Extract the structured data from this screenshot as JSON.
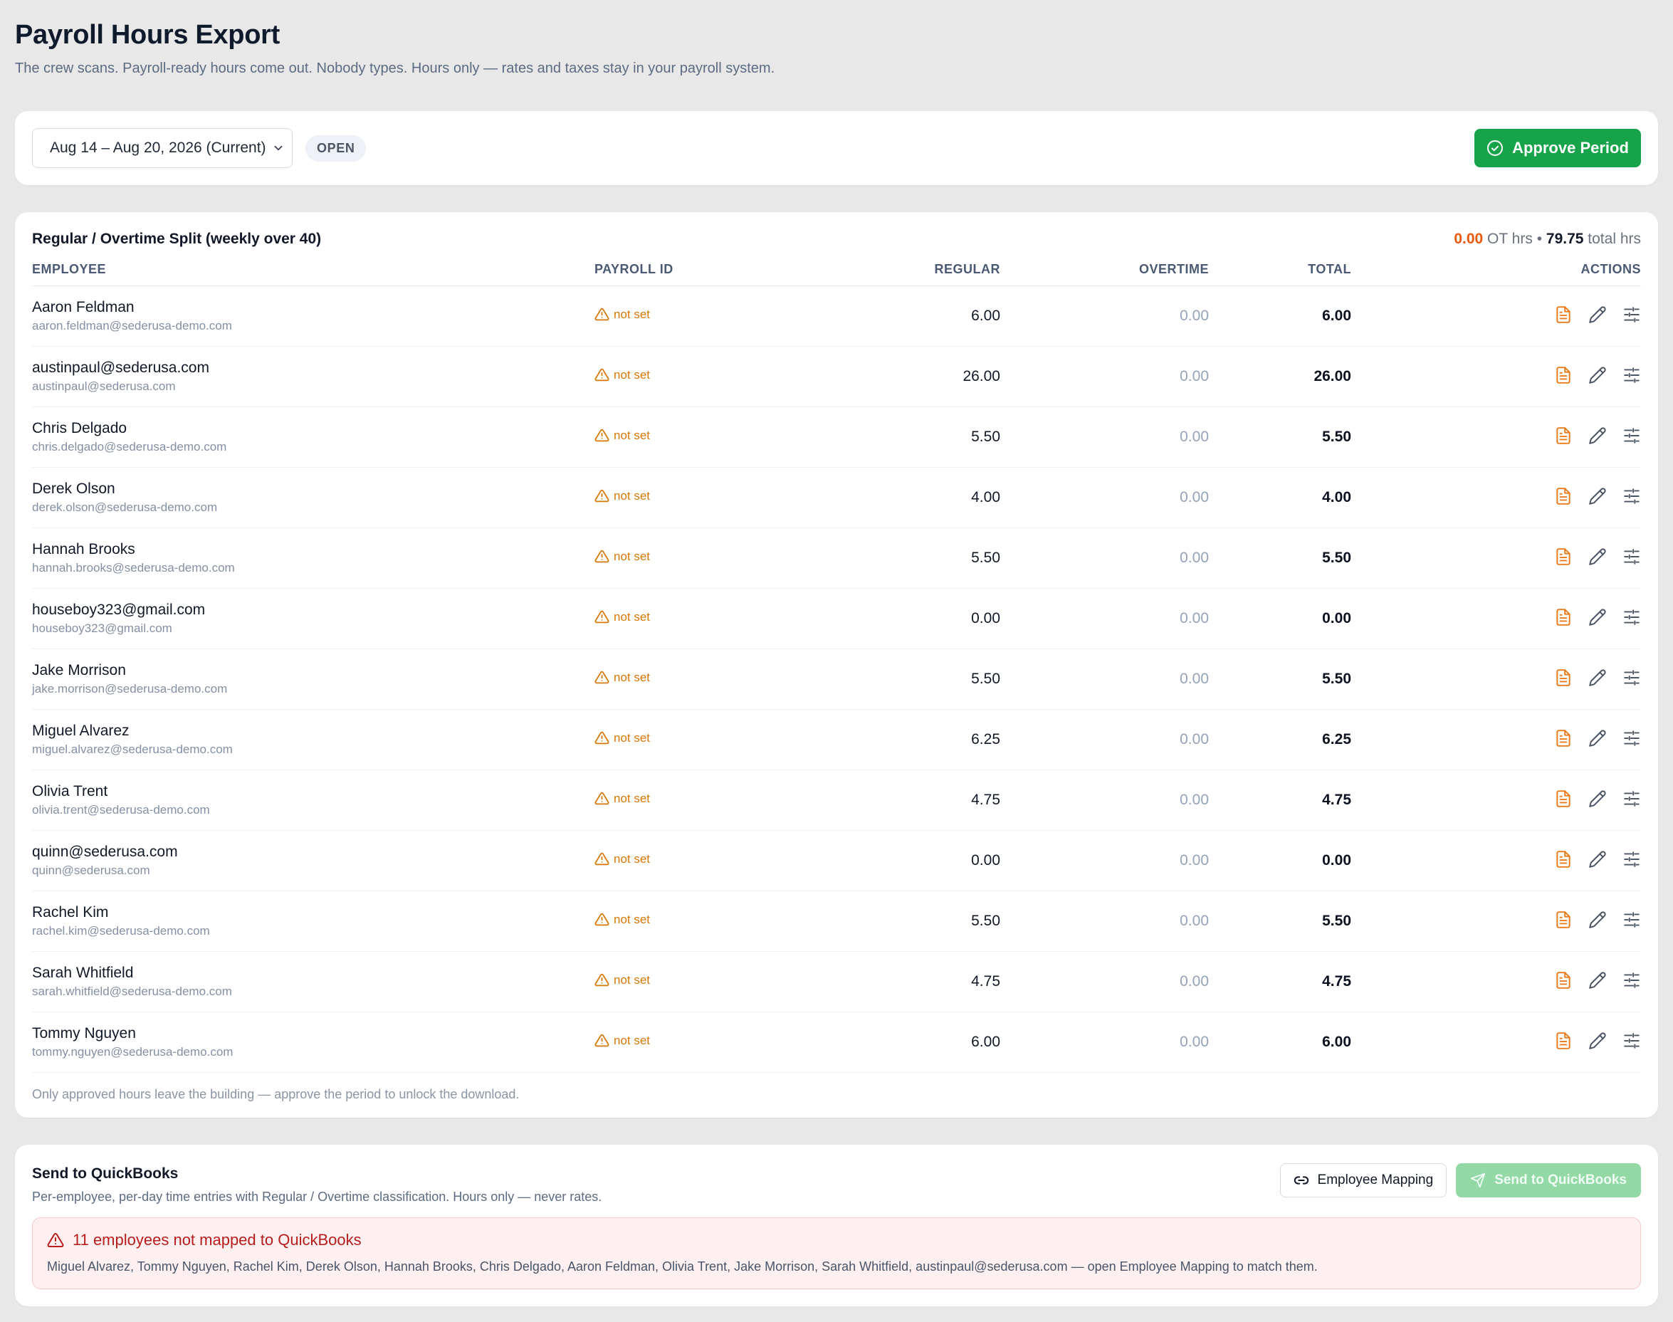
{
  "header": {
    "title": "Payroll Hours Export",
    "subtitle": "The crew scans. Payroll-ready hours come out. Nobody types. Hours only — rates and taxes stay in your payroll system."
  },
  "period": {
    "selected": "Aug 14 – Aug 20, 2026 (Current)",
    "status": "OPEN",
    "approve_label": "Approve Period"
  },
  "split": {
    "title": "Regular / Overtime Split (weekly over 40)",
    "ot_hours": "0.00",
    "ot_label": "OT hrs",
    "separator": "•",
    "total_hours": "79.75",
    "total_label": "total hrs",
    "columns": {
      "employee": "EMPLOYEE",
      "payroll_id": "PAYROLL ID",
      "regular": "REGULAR",
      "overtime": "OVERTIME",
      "total": "TOTAL",
      "actions": "ACTIONS"
    },
    "rows": [
      {
        "name": "Aaron Feldman",
        "email": "aaron.feldman@sederusa-demo.com",
        "payroll_id": "not set",
        "regular": "6.00",
        "overtime": "0.00",
        "total": "6.00"
      },
      {
        "name": "austinpaul@sederusa.com",
        "email": "austinpaul@sederusa.com",
        "payroll_id": "not set",
        "regular": "26.00",
        "overtime": "0.00",
        "total": "26.00"
      },
      {
        "name": "Chris Delgado",
        "email": "chris.delgado@sederusa-demo.com",
        "payroll_id": "not set",
        "regular": "5.50",
        "overtime": "0.00",
        "total": "5.50"
      },
      {
        "name": "Derek Olson",
        "email": "derek.olson@sederusa-demo.com",
        "payroll_id": "not set",
        "regular": "4.00",
        "overtime": "0.00",
        "total": "4.00"
      },
      {
        "name": "Hannah Brooks",
        "email": "hannah.brooks@sederusa-demo.com",
        "payroll_id": "not set",
        "regular": "5.50",
        "overtime": "0.00",
        "total": "5.50"
      },
      {
        "name": "houseboy323@gmail.com",
        "email": "houseboy323@gmail.com",
        "payroll_id": "not set",
        "regular": "0.00",
        "overtime": "0.00",
        "total": "0.00"
      },
      {
        "name": "Jake Morrison",
        "email": "jake.morrison@sederusa-demo.com",
        "payroll_id": "not set",
        "regular": "5.50",
        "overtime": "0.00",
        "total": "5.50"
      },
      {
        "name": "Miguel Alvarez",
        "email": "miguel.alvarez@sederusa-demo.com",
        "payroll_id": "not set",
        "regular": "6.25",
        "overtime": "0.00",
        "total": "6.25"
      },
      {
        "name": "Olivia Trent",
        "email": "olivia.trent@sederusa-demo.com",
        "payroll_id": "not set",
        "regular": "4.75",
        "overtime": "0.00",
        "total": "4.75"
      },
      {
        "name": "quinn@sederusa.com",
        "email": "quinn@sederusa.com",
        "payroll_id": "not set",
        "regular": "0.00",
        "overtime": "0.00",
        "total": "0.00"
      },
      {
        "name": "Rachel Kim",
        "email": "rachel.kim@sederusa-demo.com",
        "payroll_id": "not set",
        "regular": "5.50",
        "overtime": "0.00",
        "total": "5.50"
      },
      {
        "name": "Sarah Whitfield",
        "email": "sarah.whitfield@sederusa-demo.com",
        "payroll_id": "not set",
        "regular": "4.75",
        "overtime": "0.00",
        "total": "4.75"
      },
      {
        "name": "Tommy Nguyen",
        "email": "tommy.nguyen@sederusa-demo.com",
        "payroll_id": "not set",
        "regular": "6.00",
        "overtime": "0.00",
        "total": "6.00"
      }
    ],
    "row_actions": [
      "file-icon",
      "pencil-icon",
      "sliders-icon"
    ],
    "footnote": "Only approved hours leave the building — approve the period to unlock the download."
  },
  "quickbooks": {
    "title": "Send to QuickBooks",
    "description": "Per-employee, per-day time entries with Regular / Overtime classification. Hours only — never rates.",
    "mapping_label": "Employee Mapping",
    "send_label": "Send to QuickBooks",
    "alert_title": "11 employees not mapped to QuickBooks",
    "alert_body": "Miguel Alvarez, Tommy Nguyen, Rachel Kim, Derek Olson, Hannah Brooks, Chris Delgado, Aaron Feldman, Olivia Trent, Jake Morrison, Sarah Whitfield, austinpaul@sederusa.com — open Employee Mapping to match them."
  },
  "colors": {
    "approve": "#16a34a",
    "overtime_accent": "#ea580c",
    "warning": "#d97706",
    "alert_text": "#b91c1c",
    "alert_bg": "#fef0f0"
  }
}
